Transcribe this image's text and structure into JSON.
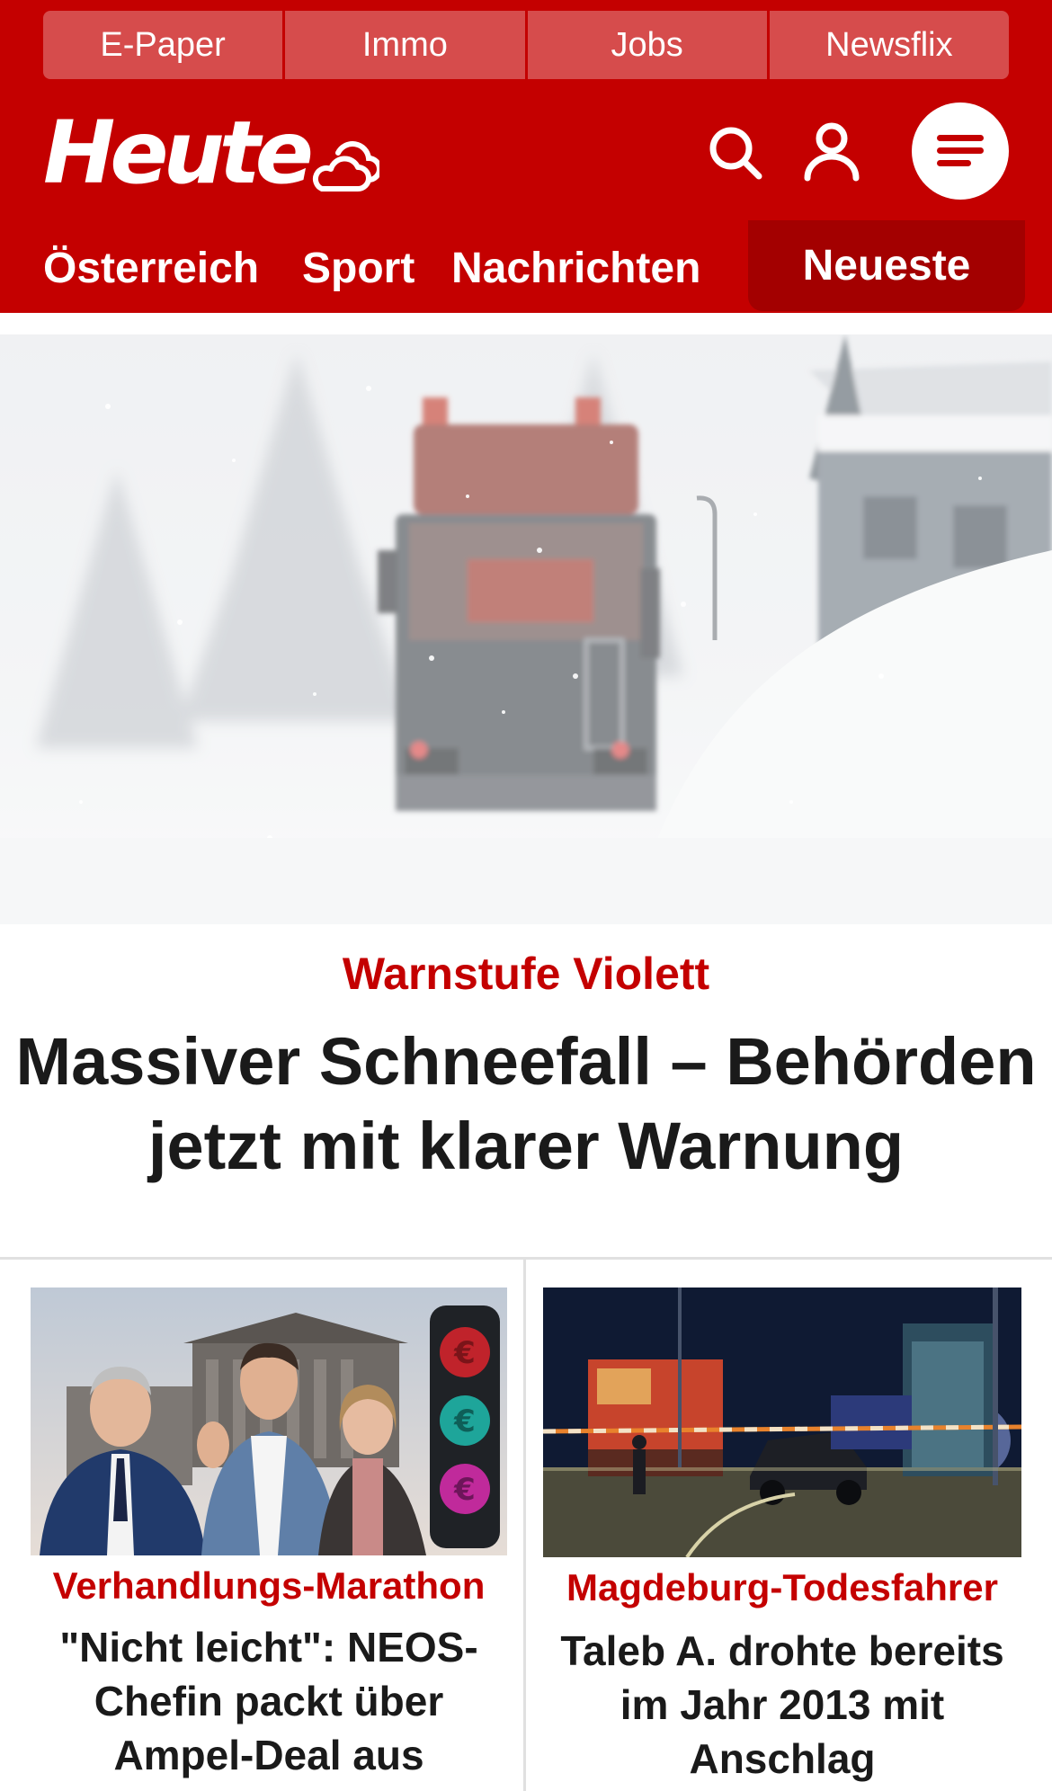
{
  "quicklinks": [
    "E-Paper",
    "Immo",
    "Jobs",
    "Newsflix"
  ],
  "header": {
    "logo": "Heute"
  },
  "nav": {
    "items": [
      "Österreich",
      "Sport",
      "Nachrichten"
    ],
    "highlight": "Neueste"
  },
  "hero": {
    "kicker": "Warnstufe Violett",
    "headline_line1": "Massiver Schneefall – Behörden",
    "headline_line2": "jetzt mit klarer Warnung"
  },
  "cards": [
    {
      "kicker": "Verhandlungs-Marathon",
      "lines": [
        "\"Nicht leicht\": NEOS-",
        "Chefin packt über",
        "Ampel-Deal aus"
      ]
    },
    {
      "kicker": "Magdeburg-Todesfahrer",
      "lines": [
        "Taleb A. drohte bereits",
        "im Jahr 2013 mit",
        "Anschlag"
      ]
    }
  ],
  "colors": {
    "brand": "#c40000",
    "brand_dark": "#a30000",
    "quicklink_bg": "#d64c4c",
    "text": "#1a1a1a"
  }
}
